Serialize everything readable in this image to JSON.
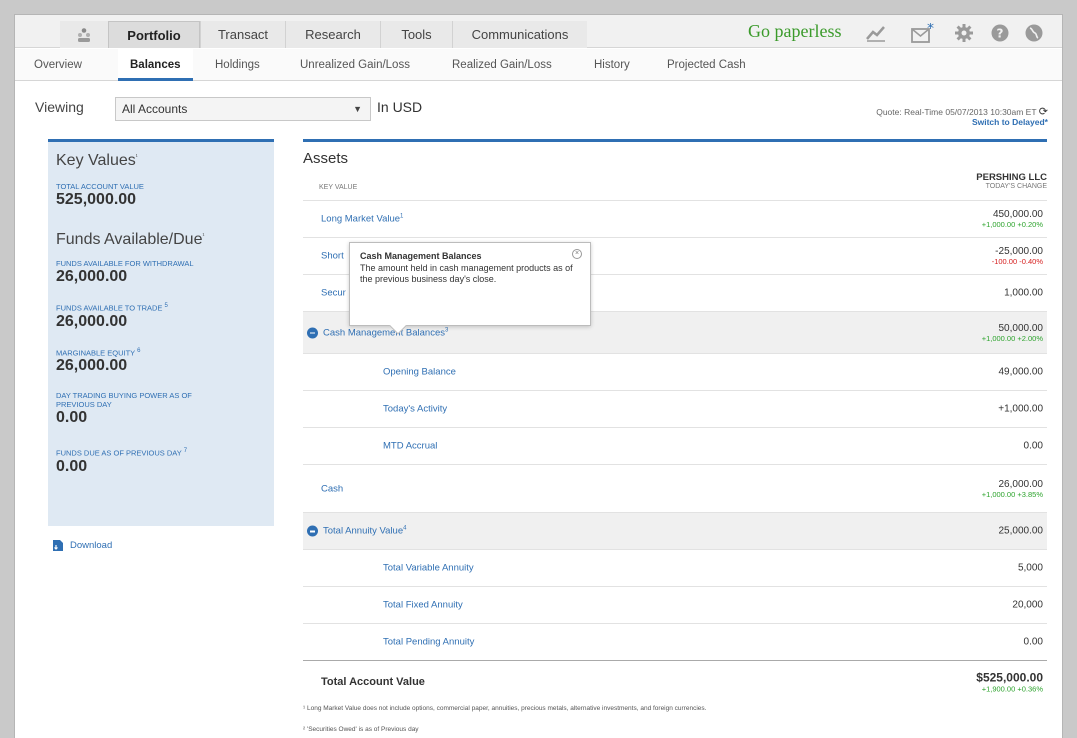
{
  "nav": {
    "tabs": [
      "Portfolio",
      "Transact",
      "Research",
      "Tools",
      "Communications"
    ],
    "go_paperless": "Go paperless"
  },
  "subnav": [
    "Overview",
    "Balances",
    "Holdings",
    "Unrealized Gain/Loss",
    "Realized Gain/Loss",
    "History",
    "Projected Cash"
  ],
  "viewing": {
    "label": "Viewing",
    "account": "All Accounts",
    "currency": "In USD",
    "quote": "Quote: Real-Time 05/07/2013 10:30am ET",
    "switch": "Switch to Delayed*"
  },
  "left": {
    "key_values_title": "Key Values",
    "key_values_title_mark": "¹",
    "total_label": "TOTAL ACCOUNT VALUE",
    "total_value": "525,000.00",
    "funds_title": "Funds Available/Due",
    "funds_title_mark": "¹",
    "items": [
      {
        "label": "FUNDS AVAILABLE FOR WITHDRAWAL",
        "sup": "",
        "value": "26,000.00"
      },
      {
        "label": "FUNDS AVAILABLE TO TRADE",
        "sup": "5",
        "value": "26,000.00"
      },
      {
        "label": "MARGINABLE EQUITY",
        "sup": "6",
        "value": "26,000.00"
      },
      {
        "label": "DAY TRADING BUYING POWER AS OF PREVIOUS DAY",
        "sup": "",
        "value": "0.00"
      },
      {
        "label": "FUNDS DUE AS OF PREVIOUS DAY",
        "sup": "7",
        "value": "0.00"
      }
    ],
    "download": "Download"
  },
  "assets": {
    "title": "Assets",
    "key_value_header": "KEY VALUE",
    "account_name": "PERSHING LLC",
    "change_header": "TODAY'S CHANGE",
    "rows": {
      "long_market": {
        "label": "Long Market Value",
        "sup": "1",
        "value": "450,000.00",
        "change": "+1,000.00  +0.20%"
      },
      "short": {
        "label": "Short",
        "value": "-25,000.00",
        "change": "-100.00  -0.40%"
      },
      "securities": {
        "label": "Secur",
        "value": "1,000.00"
      },
      "cash_mgmt": {
        "label": "Cash Management Balances",
        "sup": "3",
        "value": "50,000.00",
        "change": "+1,000.00  +2.00%"
      },
      "opening": {
        "label": "Opening Balance",
        "value": "49,000.00"
      },
      "todays_activity": {
        "label": "Today's Activity",
        "value": "+1,000.00"
      },
      "mtd": {
        "label": "MTD Accrual",
        "value": "0.00"
      },
      "cash": {
        "label": "Cash",
        "value": "26,000.00",
        "change": "+1,000.00  +3.85%"
      },
      "total_annuity": {
        "label": "Total Annuity Value",
        "sup": "4",
        "value": "25,000.00"
      },
      "variable": {
        "label": "Total Variable Annuity",
        "value": "5,000"
      },
      "fixed": {
        "label": "Total Fixed Annuity",
        "value": "20,000"
      },
      "pending": {
        "label": "Total Pending Annuity",
        "value": "0.00"
      },
      "total": {
        "label": "Total Account Value",
        "value": "$525,000.00",
        "change": "+1,900.00  +0.36%"
      }
    }
  },
  "tooltip": {
    "title": "Cash Management Balances",
    "body": "The amount held in cash management products as of the previous business day's close.",
    "close_glyph": "×"
  },
  "footnotes": [
    "¹ Long Market Value does not include options, commercial paper, annuities, precious metals, alternative investments, and foreign currencies.",
    "² 'Securities Owed' is as of Previous day"
  ],
  "colors": {
    "accent": "#2f6fb3",
    "positive": "#2da32d",
    "negative": "#d62020",
    "brand_green": "#3a9a2a"
  }
}
